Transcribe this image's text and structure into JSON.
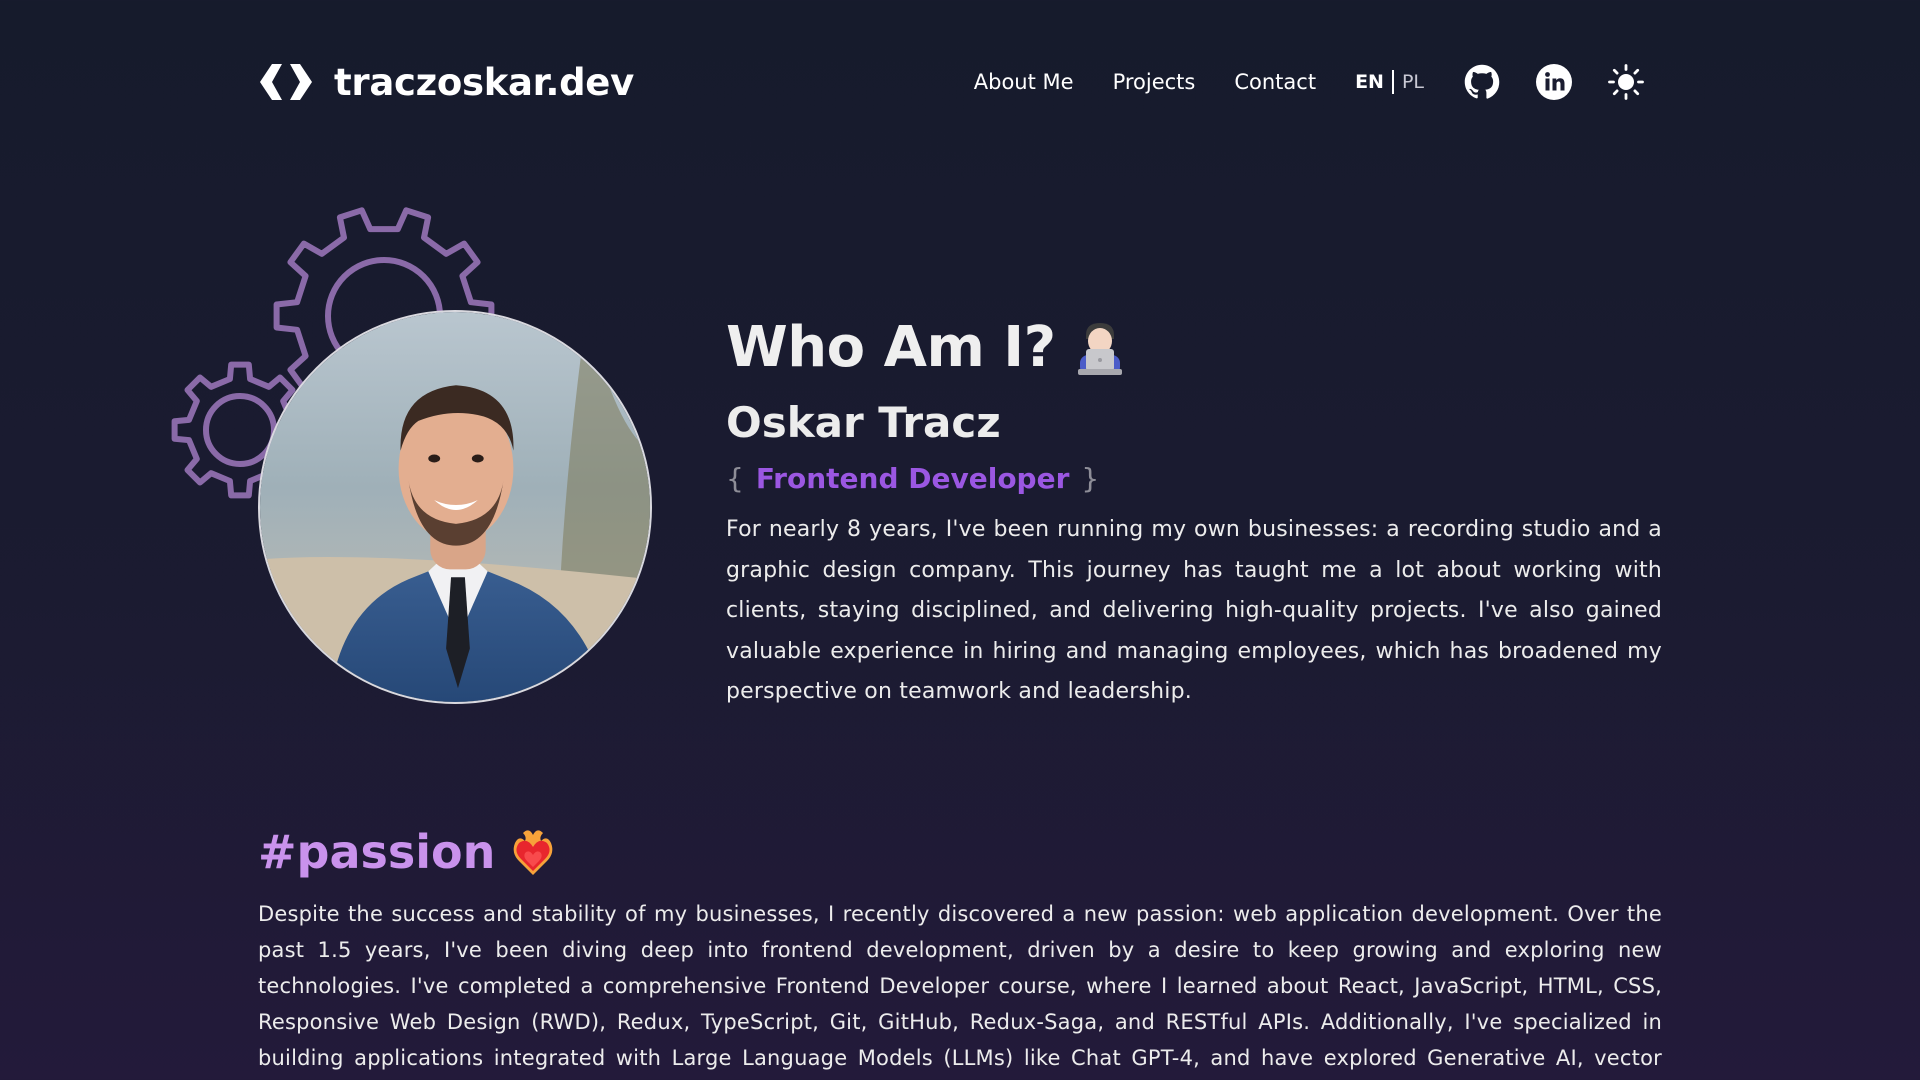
{
  "header": {
    "site_name": "traczoskar.dev",
    "nav": [
      "About Me",
      "Projects",
      "Contact"
    ],
    "lang_active": "EN",
    "lang_other": "PL",
    "icons": [
      "code-logo-icon",
      "github-icon",
      "linkedin-icon",
      "sun-icon"
    ]
  },
  "hero": {
    "title": "Who Am I?",
    "title_emoji": "technologist-emoji",
    "name": "Oskar Tracz",
    "role_open": "{",
    "role": "Frontend Developer",
    "role_close": "}",
    "description": "For nearly 8 years, I've been running my own businesses: a recording studio and a graphic design company. This journey has taught me a lot about working with clients, staying disciplined, and delivering high-quality projects. I've also gained valuable experience in hiring and managing employees, which has broadened my perspective on teamwork and leadership."
  },
  "passion": {
    "title": "#passion",
    "title_emoji": "heart-on-fire-emoji",
    "description": "Despite the success and stability of my businesses, I recently discovered a new passion: web application development. Over the past 1.5 years, I've been diving deep into frontend development, driven by a desire to keep growing and exploring new technologies. I've completed a comprehensive Frontend Developer course, where I learned about React, JavaScript, HTML, CSS, Responsive Web Design (RWD), Redux, TypeScript, Git, GitHub, Redux-Saga, and RESTful APIs. Additionally, I've specialized in building applications integrated with Large Language Models (LLMs) like Chat GPT-4, and have explored Generative AI, vector databases, function calling, and API"
  },
  "colors": {
    "background_top": "#161b2c",
    "background_bottom": "#231a3a",
    "accent_purple": "#9b57e2",
    "passion_pink": "#c992ec",
    "gear_outline": "#8a6aa8"
  }
}
